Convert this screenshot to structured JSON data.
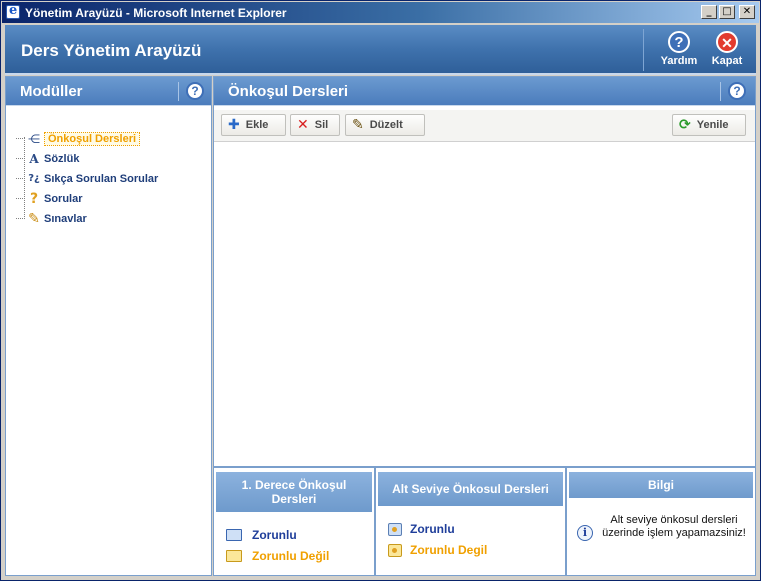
{
  "window": {
    "title": "Yönetim Arayüzü - Microsoft Internet Explorer",
    "minimize": "_",
    "maximize": "□",
    "close": "✕"
  },
  "header": {
    "title": "Ders Yönetim Arayüzü",
    "help_label": "Yardım",
    "help_glyph": "?",
    "close_label": "Kapat",
    "close_glyph": "✕"
  },
  "sidebar": {
    "title": "Modüller",
    "help_glyph": "?",
    "items": [
      {
        "label": "Önkoşul Dersleri",
        "icon": "prerequisite-tree-icon",
        "glyph": "⋲",
        "selected": true
      },
      {
        "label": "Sözlük",
        "icon": "dictionary-a-icon",
        "glyph": "A"
      },
      {
        "label": "Sıkça Sorulan Sorular",
        "icon": "faq-icon",
        "glyph": "?¿"
      },
      {
        "label": "Sorular",
        "icon": "question-icon",
        "glyph": "?"
      },
      {
        "label": "Sınavlar",
        "icon": "pen-icon",
        "glyph": "✎"
      }
    ]
  },
  "main": {
    "title": "Önkoşul Dersleri",
    "help_glyph": "?",
    "toolbar": {
      "add_label": "Ekle",
      "add_glyph": "✚",
      "delete_label": "Sil",
      "delete_glyph": "✕",
      "edit_label": "Düzelt",
      "edit_glyph": "✎",
      "refresh_label": "Yenile",
      "refresh_glyph": "⟳"
    }
  },
  "info_panels": {
    "first_degree": {
      "title": "1. Derece Önkoşul Dersleri",
      "required": "Zorunlu",
      "not_required": "Zorunlu Değil"
    },
    "sub_level": {
      "title": "Alt Seviye Önkosul Dersleri",
      "required": "Zorunlu",
      "not_required": "Zorunlu Degil"
    },
    "info": {
      "title": "Bilgi",
      "glyph": "i",
      "message": "Alt seviye önkosul dersleri üzerinde işlem yapamazsiniz!"
    }
  },
  "colors": {
    "header_blue": "#3f72ad",
    "panel_blue": "#4b7cbc",
    "selected_orange": "#f0a000",
    "link_blue": "#1f3e9a",
    "close_red": "#e23b2e"
  }
}
